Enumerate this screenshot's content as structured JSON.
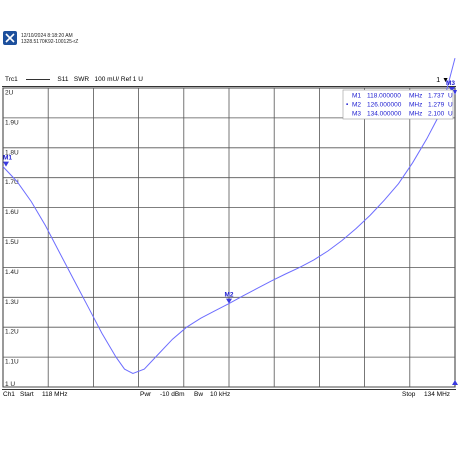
{
  "header": {
    "timestamp": "12/10/2024 8:18:20 AM",
    "device_id": "1328.5170K92-100125-rZ",
    "logo_icon": "rohde-schwarz-logo-icon"
  },
  "trace": {
    "name": "Trc1",
    "param": "S11",
    "format": "SWR",
    "scale": "100 mU/",
    "ref": "Ref 1 U",
    "channel_indicator": "1",
    "color": "#6d6dff"
  },
  "markers": {
    "rows": [
      {
        "label": "M1",
        "freq": "118.000000",
        "unit": "MHz",
        "value": "1.737",
        "vunit": "U",
        "active": false
      },
      {
        "label": "M2",
        "freq": "126.000000",
        "unit": "MHz",
        "value": "1.279",
        "vunit": "U",
        "active": true
      },
      {
        "label": "M3",
        "freq": "134.000000",
        "unit": "MHz",
        "value": "2.100",
        "vunit": "U",
        "active": false
      }
    ],
    "active_symbol": "•"
  },
  "footer": {
    "channel": "Ch1",
    "start_label": "Start",
    "start_value": "118 MHz",
    "pwr_label": "Pwr",
    "pwr_value": "-10 dBm",
    "bw_label": "Bw",
    "bw_value": "10 kHz",
    "stop_label": "Stop",
    "stop_value": "134 MHz"
  },
  "chart_data": {
    "type": "line",
    "x_unit": "MHz",
    "y_unit": "U",
    "xlim": [
      118,
      134
    ],
    "ylim": [
      1.0,
      2.0
    ],
    "grid": true,
    "x_divisions": 10,
    "y_tick_labels": [
      "2U",
      "1.9U",
      "1.8U",
      "1.7U",
      "1.6U",
      "1.5U",
      "1.4U",
      "1.3U",
      "1.2U",
      "1.1U",
      "1 U"
    ],
    "y_ticks": [
      2.0,
      1.9,
      1.8,
      1.7,
      1.6,
      1.5,
      1.4,
      1.3,
      1.2,
      1.1,
      1.0
    ],
    "series": [
      {
        "x": [
          118.0,
          118.5,
          119.0,
          119.5,
          120.0,
          120.5,
          121.0,
          121.5,
          122.0,
          122.3,
          122.6,
          123.0,
          123.5,
          124.0,
          124.5,
          125.0,
          125.5,
          126.0,
          126.5,
          127.0,
          127.5,
          128.0,
          128.5,
          129.0,
          129.5,
          130.0,
          130.5,
          131.0,
          131.5,
          132.0,
          132.5,
          133.0,
          133.5,
          134.0
        ],
        "y": [
          1.737,
          1.687,
          1.62,
          1.54,
          1.45,
          1.36,
          1.27,
          1.18,
          1.1,
          1.06,
          1.045,
          1.06,
          1.11,
          1.16,
          1.2,
          1.23,
          1.255,
          1.279,
          1.305,
          1.33,
          1.355,
          1.378,
          1.4,
          1.425,
          1.455,
          1.49,
          1.53,
          1.575,
          1.625,
          1.68,
          1.75,
          1.83,
          1.92,
          2.1
        ]
      }
    ],
    "markers": [
      {
        "name": "M1",
        "x": 118.0,
        "y": 1.737
      },
      {
        "name": "M2",
        "x": 126.0,
        "y": 1.279
      },
      {
        "name": "M3",
        "x": 134.0,
        "y": 2.1
      }
    ]
  }
}
